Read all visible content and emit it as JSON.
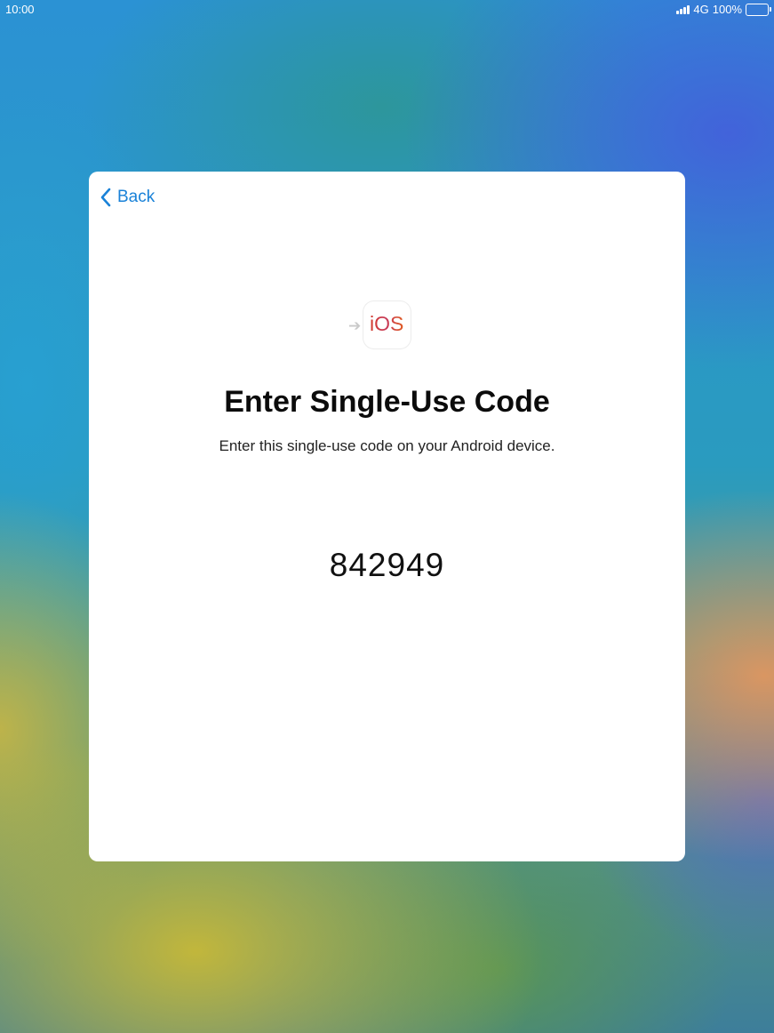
{
  "status_bar": {
    "time": "10:00",
    "network": "4G",
    "battery": "100%",
    "icons": [
      "signal-icon",
      "battery-icon"
    ]
  },
  "dialog": {
    "back_label": "Back",
    "back_icon": "chevron-left-icon",
    "app_icon_text": "iOS",
    "app_icon_arrow": "arrow-right-icon",
    "title": "Enter Single-Use Code",
    "subtitle": "Enter this single-use code on your Android device.",
    "code": "842949"
  },
  "colors": {
    "accent": "#1a82d8",
    "card_background": "#ffffff",
    "title_text": "#0b0b0b"
  }
}
